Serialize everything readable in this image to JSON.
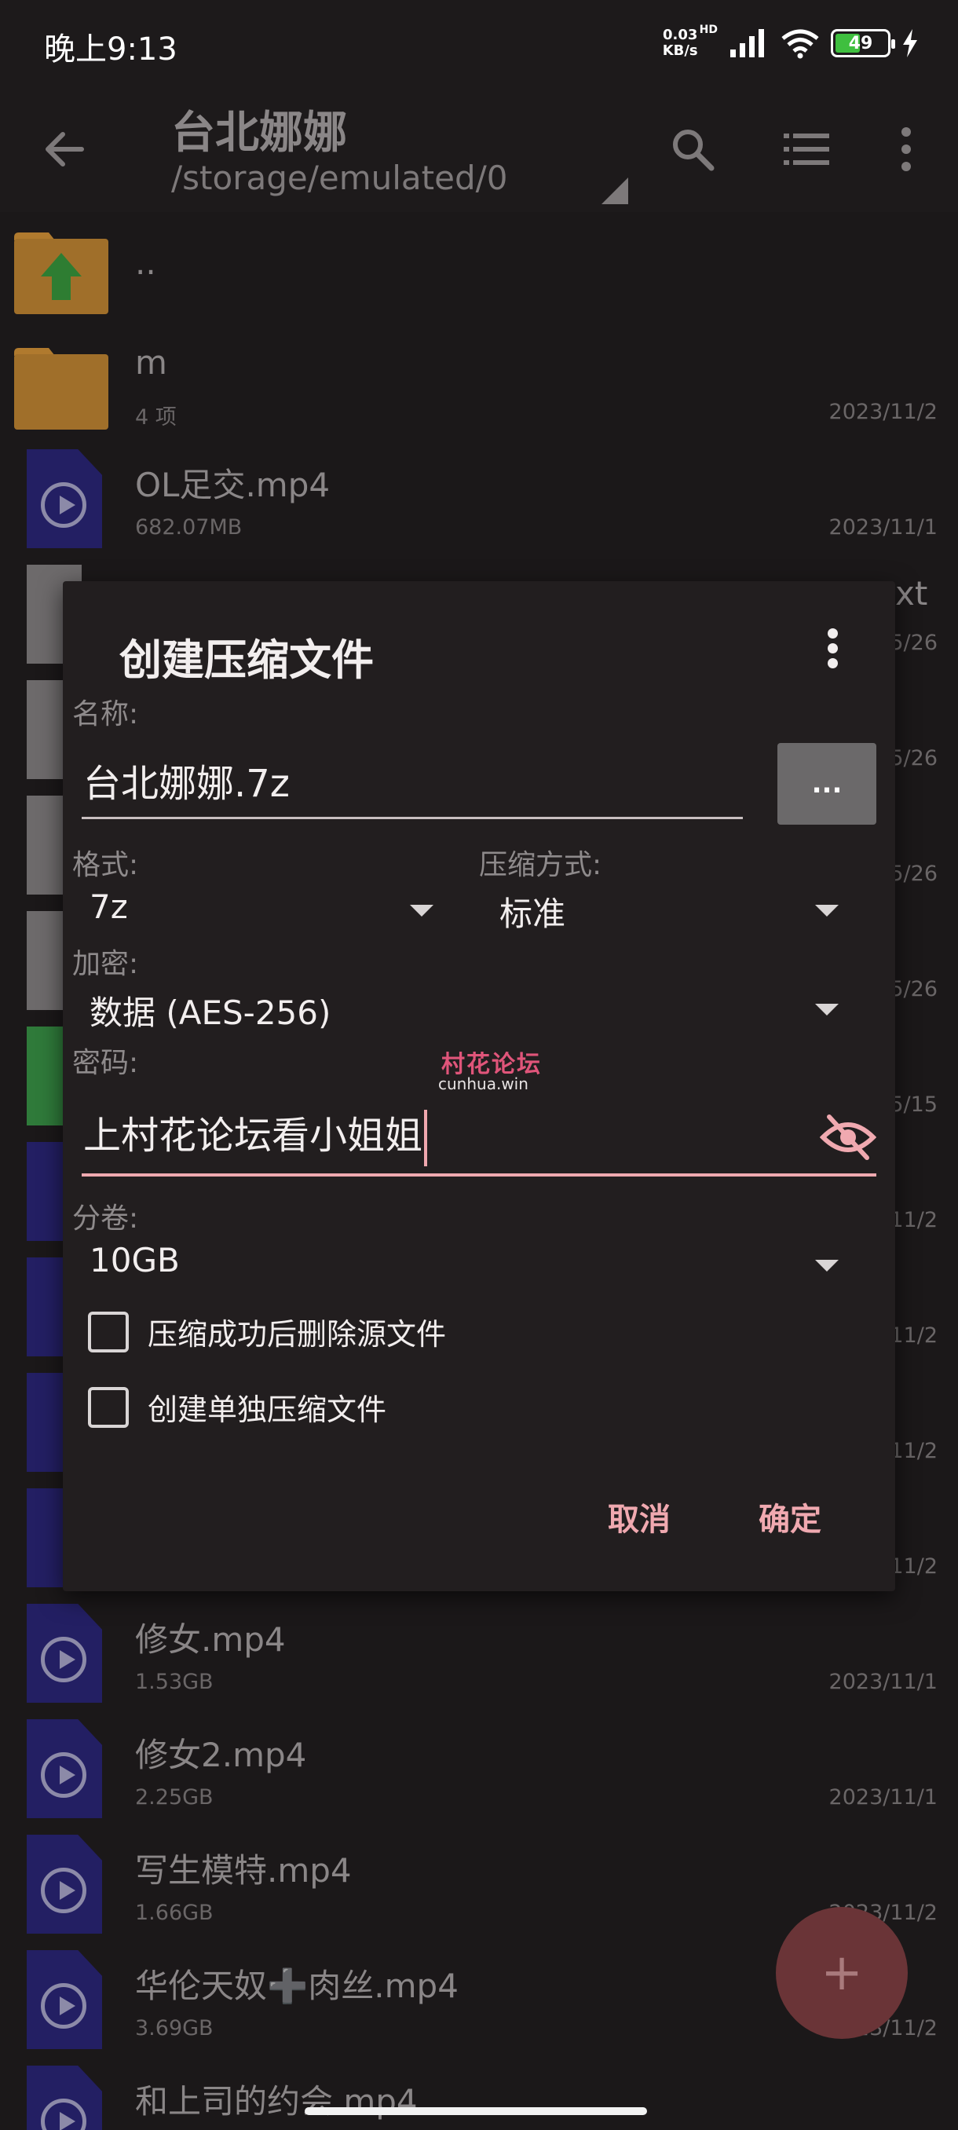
{
  "status_bar": {
    "time": "晚上9:13",
    "net_speed_value": "0.03",
    "net_speed_unit": "KB/s",
    "hd_label": "HD",
    "battery": "49",
    "battery_level": 0.49
  },
  "app_bar": {
    "title": "台北娜娜",
    "path": "/storage/emulated/0"
  },
  "files": [
    {
      "name": "..",
      "meta": "",
      "date": "",
      "type": "parent"
    },
    {
      "name": "m",
      "meta": "4 项",
      "date": "2023/11/2",
      "type": "folder"
    },
    {
      "name": "OL足交.mp4",
      "meta": "682.07MB",
      "date": "2023/11/1",
      "type": "video"
    },
    {
      "name": "修女.mp4",
      "meta": "1.53GB",
      "date": "2023/11/1",
      "type": "video"
    },
    {
      "name": "修女2.mp4",
      "meta": "2.25GB",
      "date": "2023/11/1",
      "type": "video"
    },
    {
      "name": "写生模特.mp4",
      "meta": "1.66GB",
      "date": "2023/11/2",
      "type": "video"
    },
    {
      "name": "华伦天奴➕肉丝.mp4",
      "meta": "3.69GB",
      "date": "2023/11/2",
      "type": "video"
    },
    {
      "name": "和上司的约会.mp4",
      "meta": "",
      "date": "",
      "type": "video"
    }
  ],
  "behind_dialog_fragments": {
    "row1_tail": "xt",
    "row1_date": "5/26",
    "row2_date": "5/26",
    "row3_date": "5/26",
    "row4_date": "5/26",
    "row5_date": "5/15",
    "row6_date": "11/2",
    "row7_date": "11/2",
    "row8_date": "11/2",
    "row9_date": "11/2"
  },
  "dialog": {
    "title": "创建压缩文件",
    "name_label": "名称:",
    "name_value": "台北娜娜.7z",
    "browse_button": "...",
    "format_label": "格式:",
    "format_value": "7z",
    "method_label": "压缩方式:",
    "method_value": "标准",
    "encryption_label": "加密:",
    "encryption_value": "数据 (AES-256)",
    "password_label": "密码:",
    "password_value": "上村花论坛看小姐姐",
    "split_label": "分卷:",
    "split_value": "10GB",
    "checkbox_delete_source": "压缩成功后删除源文件",
    "checkbox_delete_source_checked": false,
    "checkbox_separate": "创建单独压缩文件",
    "checkbox_separate_checked": false,
    "cancel_button": "取消",
    "ok_button": "确定"
  },
  "watermark": {
    "line1": "村花论坛",
    "line2": "cunhua.win"
  },
  "fab": {
    "icon": "plus-icon",
    "label": "+"
  },
  "colors": {
    "accent": "#f0a9b0",
    "dialog_bg": "#221e1f",
    "screen_bg": "#1b1819",
    "video_icon": "#231f63",
    "folder_icon": "#b07a2e"
  }
}
